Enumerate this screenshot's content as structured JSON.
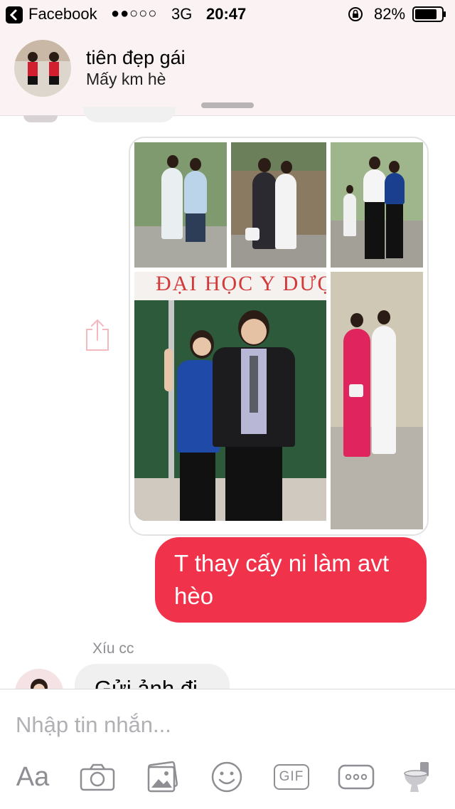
{
  "status_bar": {
    "back_app": "Facebook",
    "signal": "●●○○○",
    "network": "3G",
    "time": "20:47",
    "battery_percent": "82%",
    "battery_level": 0.82
  },
  "header": {
    "contact_name": "tiên đẹp gái",
    "status_line": "Mấy km hè"
  },
  "messages": {
    "sent_text": "T thay cấy ni làm avt hèo",
    "received_name": "Xíu cc",
    "received_text": "Gửi ảnh đi"
  },
  "photos": {
    "banner_text": "ĐẠI HỌC Y DƯỢ"
  },
  "composer": {
    "placeholder": "Nhập tin nhắn...",
    "text_tool_label": "Aa",
    "gif_label": "GIF"
  },
  "colors": {
    "accent": "#f0334a",
    "header_bg": "#fbf2f3",
    "icon_gray": "#8e8e93",
    "share_icon": "#f4b8c0"
  },
  "icons": [
    "back-icon",
    "signal-icon",
    "rotation-lock-icon",
    "battery-icon",
    "share-icon",
    "camera-icon",
    "gallery-icon",
    "emoji-icon",
    "gif-icon",
    "more-icon",
    "toilet-icon"
  ]
}
